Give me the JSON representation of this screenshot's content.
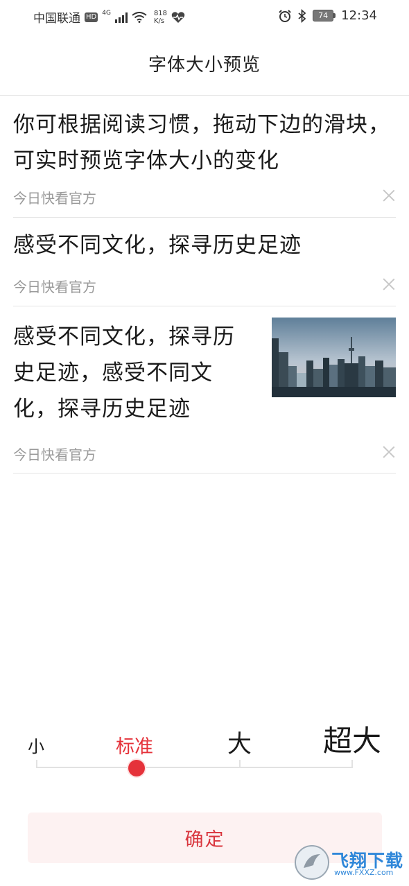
{
  "status_bar": {
    "carrier": "中国联通",
    "hd": "HD",
    "network": "4G",
    "speed_value": "818",
    "speed_unit": "K/s",
    "battery": "74",
    "time": "12:34"
  },
  "header": {
    "title": "字体大小预览"
  },
  "news": [
    {
      "title": "你可根据阅读习惯，拖动下边的滑块，可实时预览字体大小的变化",
      "source": "今日快看官方"
    },
    {
      "title": "感受不同文化，探寻历史足迹",
      "source": "今日快看官方"
    },
    {
      "title": "感受不同文化，探寻历史足迹，感受不同文化，探寻历史足迹",
      "source": "今日快看官方",
      "has_image": true
    }
  ],
  "font_size": {
    "options": [
      "小",
      "标准",
      "大",
      "超大"
    ],
    "selected": "标准",
    "selected_index": 1,
    "accent_color": "#e5323a"
  },
  "confirm_label": "确定",
  "watermark": {
    "text": "飞翔下载",
    "sub": "www.FXXZ.com"
  }
}
